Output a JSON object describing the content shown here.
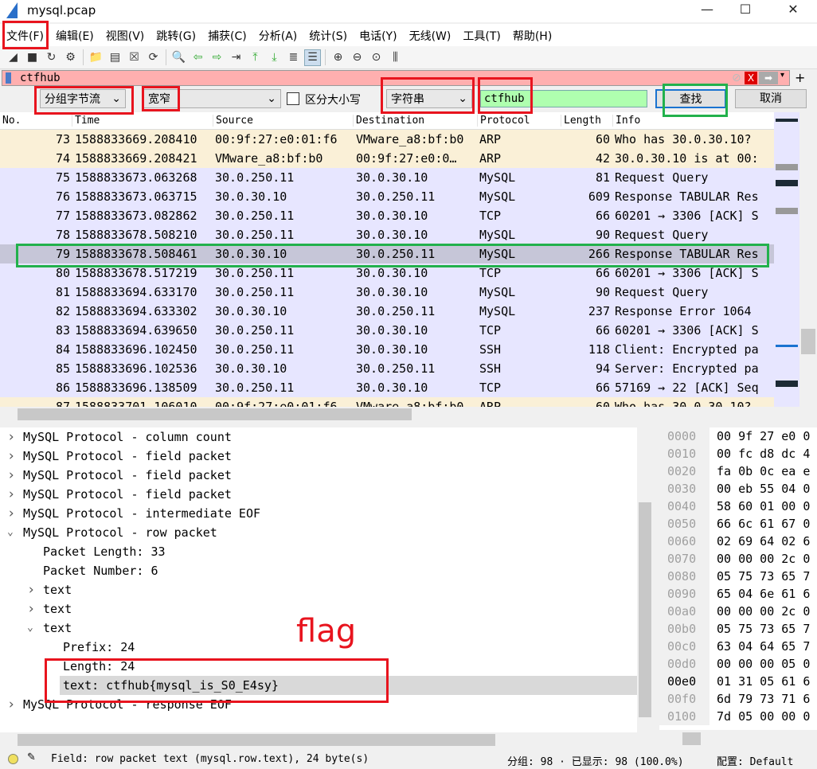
{
  "window": {
    "title": "mysql.pcap",
    "minimize": "—",
    "maximize": "☐",
    "close": "✕"
  },
  "menu": [
    "文件(F)",
    "编辑(E)",
    "视图(V)",
    "跳转(G)",
    "捕获(C)",
    "分析(A)",
    "统计(S)",
    "电话(Y)",
    "无线(W)",
    "工具(T)",
    "帮助(H)"
  ],
  "toolbar": [
    "shark-fin-icon",
    "stop-icon",
    "restart-icon",
    "options-icon",
    "open-icon",
    "file-icon",
    "close-file-icon",
    "reload-icon",
    "find-icon",
    "back-icon",
    "forward-icon",
    "goto-icon",
    "first-icon",
    "last-icon",
    "autoscroll-icon",
    "colorize-icon",
    "zoom-in-icon",
    "zoom-out-icon",
    "zoom-reset-icon",
    "resize-columns-icon"
  ],
  "filter": {
    "value": "ctfhub",
    "background": "#ffafaf"
  },
  "find": {
    "search_in": "分组字节流",
    "charset": "宽窄",
    "case_label": "区分大小写",
    "case_checked": false,
    "type": "字符串",
    "value": "ctfhub",
    "find_btn": "查找",
    "cancel_btn": "取消"
  },
  "packet_list": {
    "columns": [
      "No.",
      "Time",
      "Source",
      "Destination",
      "Protocol",
      "Length",
      "Info"
    ],
    "rows": [
      {
        "no": "73",
        "time": "1588833669.208410",
        "src": "00:9f:27:e0:01:f6",
        "dst": "VMware_a8:bf:b0",
        "proto": "ARP",
        "len": "60",
        "info": "Who has 30.0.30.10?",
        "type": "arp"
      },
      {
        "no": "74",
        "time": "1588833669.208421",
        "src": "VMware_a8:bf:b0",
        "dst": "00:9f:27:e0:0…",
        "proto": "ARP",
        "len": "42",
        "info": "30.0.30.10 is at 00:",
        "type": "arp"
      },
      {
        "no": "75",
        "time": "1588833673.063268",
        "src": "30.0.250.11",
        "dst": "30.0.30.10",
        "proto": "MySQL",
        "len": "81",
        "info": "Request Query",
        "type": "tcp"
      },
      {
        "no": "76",
        "time": "1588833673.063715",
        "src": "30.0.30.10",
        "dst": "30.0.250.11",
        "proto": "MySQL",
        "len": "609",
        "info": "Response TABULAR Res",
        "type": "tcp"
      },
      {
        "no": "77",
        "time": "1588833673.082862",
        "src": "30.0.250.11",
        "dst": "30.0.30.10",
        "proto": "TCP",
        "len": "66",
        "info": "60201 → 3306 [ACK] S",
        "type": "tcp"
      },
      {
        "no": "78",
        "time": "1588833678.508210",
        "src": "30.0.250.11",
        "dst": "30.0.30.10",
        "proto": "MySQL",
        "len": "90",
        "info": "Request Query",
        "type": "tcp"
      },
      {
        "no": "79",
        "time": "1588833678.508461",
        "src": "30.0.30.10",
        "dst": "30.0.250.11",
        "proto": "MySQL",
        "len": "266",
        "info": "Response TABULAR Res",
        "type": "sel"
      },
      {
        "no": "80",
        "time": "1588833678.517219",
        "src": "30.0.250.11",
        "dst": "30.0.30.10",
        "proto": "TCP",
        "len": "66",
        "info": "60201 → 3306 [ACK] S",
        "type": "tcp"
      },
      {
        "no": "81",
        "time": "1588833694.633170",
        "src": "30.0.250.11",
        "dst": "30.0.30.10",
        "proto": "MySQL",
        "len": "90",
        "info": "Request Query",
        "type": "tcp"
      },
      {
        "no": "82",
        "time": "1588833694.633302",
        "src": "30.0.30.10",
        "dst": "30.0.250.11",
        "proto": "MySQL",
        "len": "237",
        "info": "Response  Error 1064",
        "type": "tcp"
      },
      {
        "no": "83",
        "time": "1588833694.639650",
        "src": "30.0.250.11",
        "dst": "30.0.30.10",
        "proto": "TCP",
        "len": "66",
        "info": "60201 → 3306 [ACK] S",
        "type": "tcp"
      },
      {
        "no": "84",
        "time": "1588833696.102450",
        "src": "30.0.250.11",
        "dst": "30.0.30.10",
        "proto": "SSH",
        "len": "118",
        "info": "Client: Encrypted pa",
        "type": "tcp"
      },
      {
        "no": "85",
        "time": "1588833696.102536",
        "src": "30.0.30.10",
        "dst": "30.0.250.11",
        "proto": "SSH",
        "len": "94",
        "info": "Server: Encrypted pa",
        "type": "tcp"
      },
      {
        "no": "86",
        "time": "1588833696.138509",
        "src": "30.0.250.11",
        "dst": "30.0.30.10",
        "proto": "TCP",
        "len": "66",
        "info": "57169 → 22 [ACK] Seq",
        "type": "tcp"
      },
      {
        "no": "87",
        "time": "1588833701.106010",
        "src": "00:9f:27:e0:01:f6",
        "dst": "VMware_a8:bf:b0",
        "proto": "ARP",
        "len": "60",
        "info": "Who has 30.0.30.10?",
        "type": "arp"
      }
    ]
  },
  "details": [
    {
      "text": "MySQL Protocol - column count",
      "level": 0,
      "state": "collapsed"
    },
    {
      "text": "MySQL Protocol - field packet",
      "level": 0,
      "state": "collapsed"
    },
    {
      "text": "MySQL Protocol - field packet",
      "level": 0,
      "state": "collapsed"
    },
    {
      "text": "MySQL Protocol - field packet",
      "level": 0,
      "state": "collapsed"
    },
    {
      "text": "MySQL Protocol - intermediate EOF",
      "level": 0,
      "state": "collapsed"
    },
    {
      "text": "MySQL Protocol - row packet",
      "level": 0,
      "state": "expanded"
    },
    {
      "text": "Packet Length: 33",
      "level": 1,
      "state": "leaf"
    },
    {
      "text": "Packet Number: 6",
      "level": 1,
      "state": "leaf"
    },
    {
      "text": "text",
      "level": 1,
      "state": "collapsed"
    },
    {
      "text": "text",
      "level": 1,
      "state": "collapsed"
    },
    {
      "text": "text",
      "level": 1,
      "state": "expanded"
    },
    {
      "text": "Prefix: 24",
      "level": 2,
      "state": "leaf"
    },
    {
      "text": "Length: 24",
      "level": 2,
      "state": "leaf"
    },
    {
      "text": "text: ctfhub{mysql_is_S0_E4sy}",
      "level": 2,
      "state": "leaf",
      "selected": true
    },
    {
      "text": "MySQL Protocol - response EOF",
      "level": 0,
      "state": "collapsed"
    }
  ],
  "hex": [
    [
      "0000",
      "00 9f 27 e0 0"
    ],
    [
      "0010",
      "00 fc d8 dc 4"
    ],
    [
      "0020",
      "fa 0b 0c ea e"
    ],
    [
      "0030",
      "00 eb 55 04 0"
    ],
    [
      "0040",
      "58 60 01 00 0"
    ],
    [
      "0050",
      "66 6c 61 67 0"
    ],
    [
      "0060",
      "02 69 64 02 6"
    ],
    [
      "0070",
      "00 00 00 2c 0"
    ],
    [
      "0080",
      "05 75 73 65 7"
    ],
    [
      "0090",
      "65 04 6e 61 6"
    ],
    [
      "00a0",
      "00 00 00 2c 0"
    ],
    [
      "00b0",
      "05 75 73 65 7"
    ],
    [
      "00c0",
      "63 04 64 65 7"
    ],
    [
      "00d0",
      "00 00 00 05 0"
    ],
    [
      "00e0",
      "01 31 05 61 6"
    ],
    [
      "00f0",
      "6d 79 73 71 6"
    ],
    [
      "0100",
      "7d 05 00 00 0"
    ]
  ],
  "status": {
    "field": "Field: row packet text (mysql.row.text), 24 byte(s)",
    "packets": "分组: 98 · 已显示: 98 (100.0%)",
    "profile": "配置: Default"
  },
  "annotation": {
    "label": "flag",
    "color": "#e8141e"
  }
}
